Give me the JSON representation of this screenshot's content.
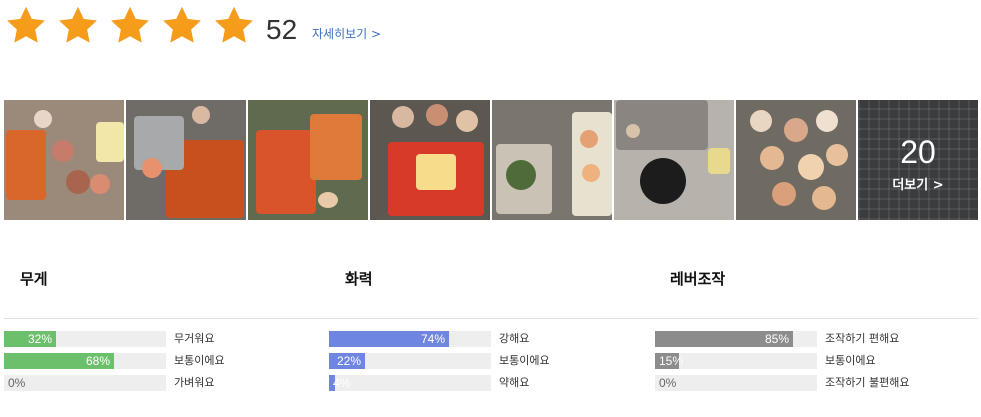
{
  "rating": {
    "star_count": 5,
    "star_color": "#f59c1a",
    "score": "52",
    "detail_link": "자세히보기 >"
  },
  "photos": {
    "more_count": "20",
    "more_label": "더보기 >"
  },
  "stats": [
    {
      "title": "무게",
      "color": "#6cc06c",
      "rows": [
        {
          "label": "무거워요",
          "value": 32,
          "text": "32%"
        },
        {
          "label": "보통이에요",
          "value": 68,
          "text": "68%"
        },
        {
          "label": "가벼워요",
          "value": 0,
          "text": "0%"
        }
      ]
    },
    {
      "title": "화력",
      "color": "#6f86e0",
      "rows": [
        {
          "label": "강해요",
          "value": 74,
          "text": "74%"
        },
        {
          "label": "보통이에요",
          "value": 22,
          "text": "22%"
        },
        {
          "label": "약해요",
          "value": 4,
          "text": "4%"
        }
      ]
    },
    {
      "title": "레버조작",
      "color": "#8c8c8c",
      "rows": [
        {
          "label": "조작하기 편해요",
          "value": 85,
          "text": "85%"
        },
        {
          "label": "보통이에요",
          "value": 15,
          "text": "15%"
        },
        {
          "label": "조작하기 불편해요",
          "value": 0,
          "text": "0%"
        }
      ]
    }
  ]
}
